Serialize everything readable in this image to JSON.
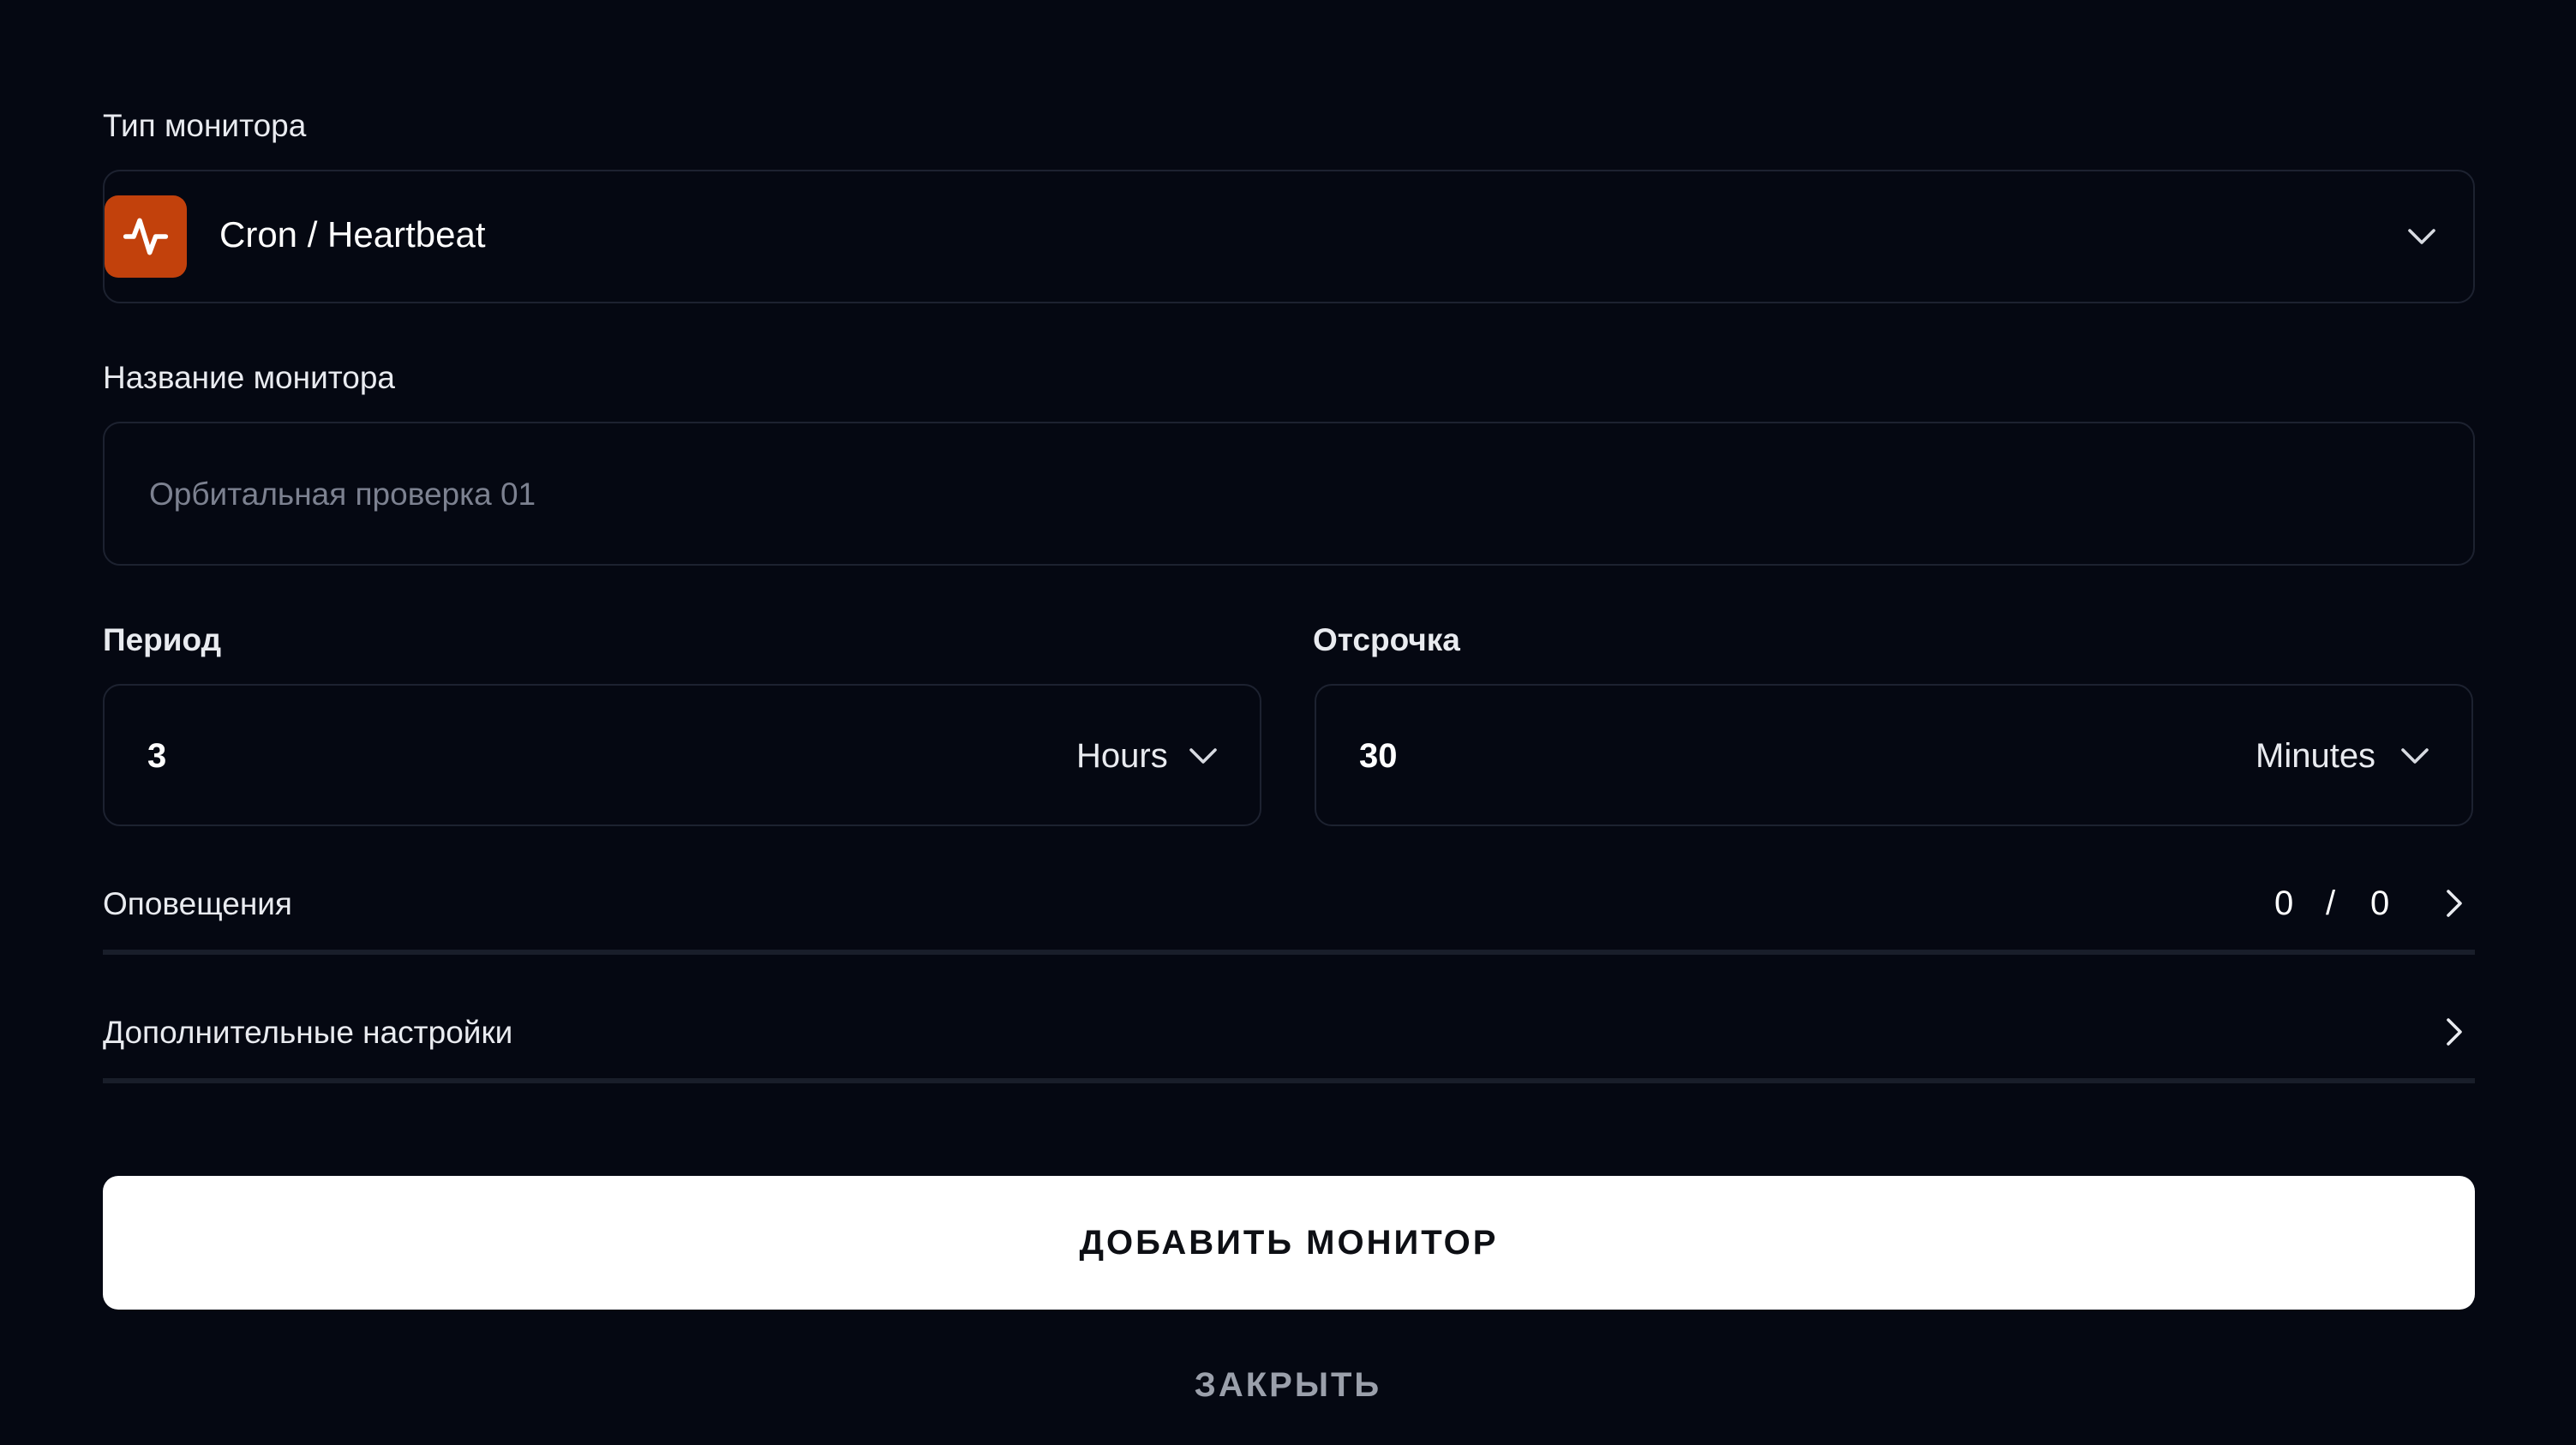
{
  "monitor_type": {
    "label": "Тип монитора",
    "selected": "Cron / Heartbeat",
    "icon": "heartbeat-icon",
    "icon_color": "#c2410c"
  },
  "monitor_name": {
    "label": "Название монитора",
    "placeholder": "Орбитальная проверка 01",
    "value": ""
  },
  "period": {
    "label": "Период",
    "value": "3",
    "unit": "Hours"
  },
  "grace": {
    "label": "Отсрочка",
    "value": "30",
    "unit": "Minutes"
  },
  "notifications": {
    "label": "Оповещения",
    "count_left": "0",
    "separator": "/",
    "count_right": "0"
  },
  "advanced": {
    "label": "Дополнительные настройки"
  },
  "actions": {
    "primary": "ДОБАВИТЬ МОНИТОР",
    "secondary": "ЗАКРЫТЬ"
  },
  "colors": {
    "background": "#050812",
    "accent": "#c2410c",
    "primary_button": "#ffffff"
  }
}
